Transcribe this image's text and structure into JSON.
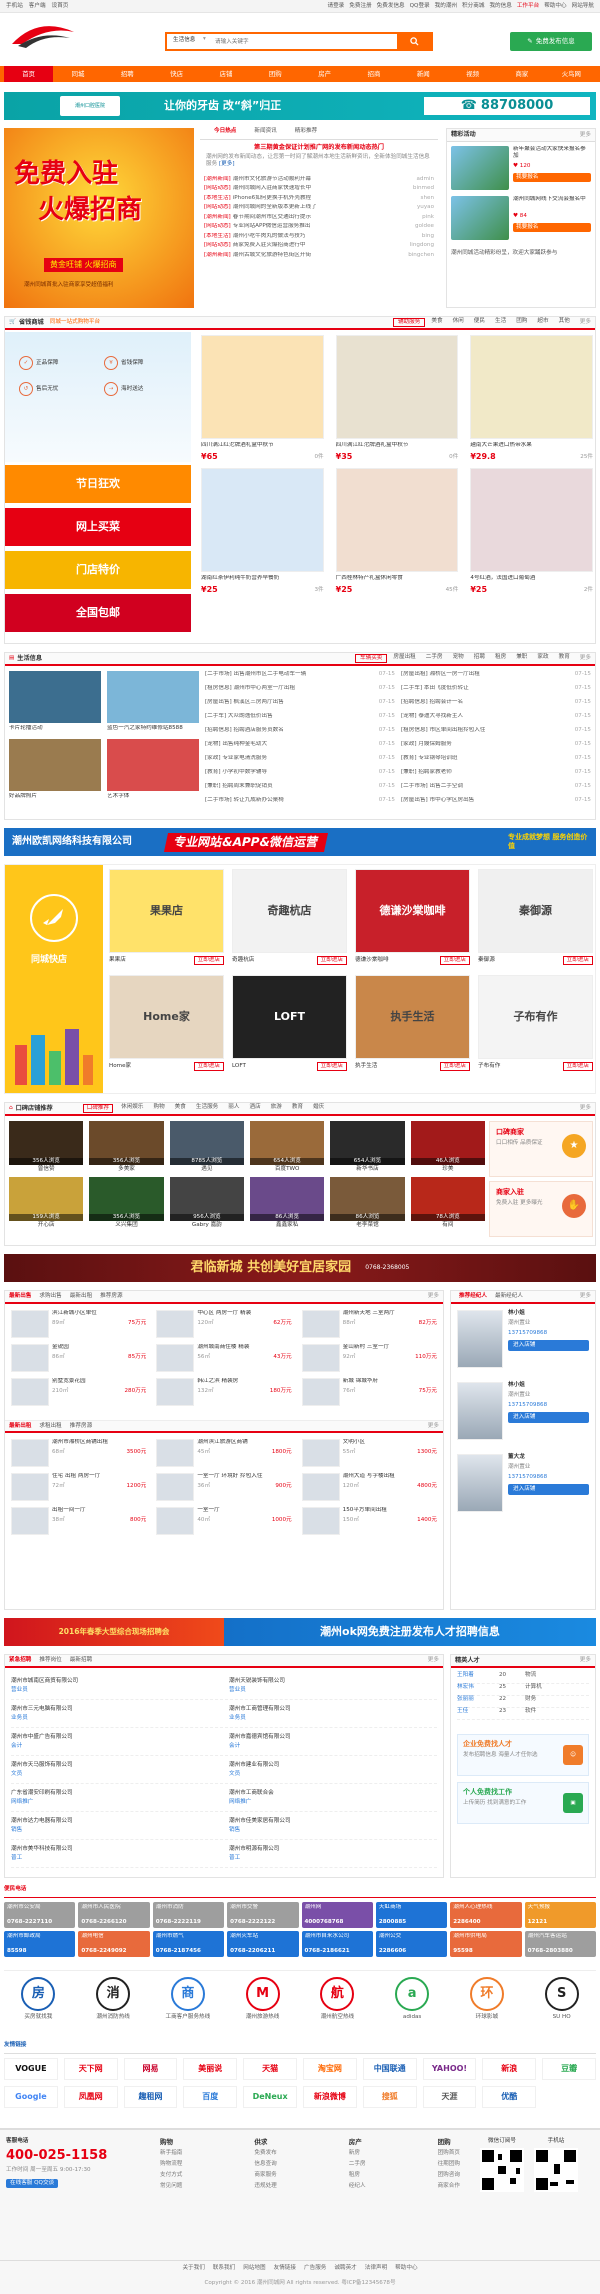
{
  "topbar": {
    "left": [
      "手机站",
      "客户端",
      "设首页"
    ],
    "right": [
      "请登录",
      "免费注册",
      "免费发信息",
      "QQ登录",
      "我的潮州",
      "积分商城",
      "我的信息",
      "工作平台",
      "帮助中心",
      "网站导航"
    ]
  },
  "header": {
    "search_tab": "生活信息",
    "search_placeholder": "请输入关键字",
    "post_button": "免费发布信息"
  },
  "nav": [
    "首页",
    "同城",
    "招聘",
    "快店",
    "店铺",
    "团购",
    "房产",
    "招商",
    "新闻",
    "视频",
    "商家",
    "火鸟网"
  ],
  "banner_ad": {
    "title": "让你的牙齿 改“斜”归正",
    "subtitle": "潮州口腔医院",
    "phone": "88708000"
  },
  "hero": {
    "line1": "免费入驻",
    "line2": "火爆招商",
    "tag": "黄金旺铺 火爆招商",
    "sub": "潮州同城首批入驻商家享受超值福利"
  },
  "news": {
    "tabs": [
      "今日热点",
      "新闻资讯",
      "精彩推荐"
    ],
    "headline": "第三期黄金保证计划推广网的发布新闻动态热门",
    "summary": "潮州网的发布新闻动态，让您第一时间了解潮州本地生活新鲜资讯，全新体验同城生活信息服务",
    "more_link": "[更多]",
    "items": [
      {
        "tag": "[潮州新闻]",
        "text": "潮州市文化旅游节活动顺利开幕",
        "src": "admin"
      },
      {
        "tag": "[网站动态]",
        "text": "潮州同城网入驻商家快速增长中",
        "src": "binmed"
      },
      {
        "tag": "[本地生活]",
        "text": "iPhone6如何更换手机外壳教程",
        "src": "shen"
      },
      {
        "tag": "[网站动态]",
        "text": "潮州同城网的全新版本更新上线了",
        "src": "yuyao"
      },
      {
        "tag": "[潮州新闻]",
        "text": "春节期间潮州市区交通出行提示",
        "src": "pink"
      },
      {
        "tag": "[网站动态]",
        "text": "专业网站APP微信运营服务推出",
        "src": "goldee"
      },
      {
        "tag": "[本地生活]",
        "text": "潮州小吃牛肉丸的做法与技巧",
        "src": "bing"
      },
      {
        "tag": "[网站动态]",
        "text": "商家免费入驻火爆招商进行中",
        "src": "lingdong"
      },
      {
        "tag": "[潮州新闻]",
        "text": "潮州古城文化旅游特色街区开街",
        "src": "bingchen"
      }
    ]
  },
  "right_panel": {
    "title": "精彩活动",
    "more": "更多",
    "activities": [
      {
        "title": "新年聚会活动大家快来报名参加",
        "count": "120",
        "button": "我要报名"
      },
      {
        "title": "潮州同城网线下交流会报名中",
        "count": "84",
        "button": "我要报名"
      }
    ],
    "caption": "潮州同城活动精彩纷呈，欢迎大家踊跃参与"
  },
  "mall": {
    "title": "省钱商城",
    "subtitle": "同城一站式购物平台",
    "tabs": [
      "辅助服务",
      "美食",
      "休闲",
      "便民",
      "生活",
      "团购",
      "超市",
      "其他"
    ],
    "more": "更多",
    "services": [
      "正品保障",
      "省钱保障",
      "售后无忧",
      "海时送达"
    ],
    "products": [
      {
        "name": "四川满江红沱牌酒礼盒中秋节",
        "price": "¥65",
        "sold": "0件"
      },
      {
        "name": "四川满江红沱牌酒礼盒中秋节",
        "price": "¥35",
        "sold": "0件"
      },
      {
        "name": "越南大芒果进口热带水果",
        "price": "¥29.8",
        "sold": "25件"
      },
      {
        "name": "湖南红茶伊利纯牛奶营养早餐奶",
        "price": "¥25",
        "sold": "3件"
      },
      {
        "name": "广西桂林特产礼盒休闲零食",
        "price": "¥25",
        "sold": "45件"
      },
      {
        "name": "4号红酒，法国进口葡萄酒",
        "price": "¥25",
        "sold": "2件"
      }
    ],
    "promos": [
      "节日狂欢",
      "网上买菜",
      "门店特价",
      "全国包邮"
    ]
  },
  "life": {
    "title": "生活信息",
    "tabs": [
      "车辆买卖",
      "房屋出租",
      "二手房",
      "宠物",
      "招聘",
      "租房",
      "兼职",
      "家政",
      "教育"
    ],
    "more": "更多",
    "photos": [
      "卡片轮播活动",
      "蓝色一汽之家特约维修站8588",
      "好品牌照片",
      "艺术字体"
    ],
    "col1": [
      "[二手市场] 出售潮州市区二手电动车一辆",
      "[租房信息] 潮州市中心两室一厅出租",
      "[房屋出售] 枫溪区三房两厅出售",
      "[二手车] 大众朗逸低价出售",
      "[招聘信息] 招聘酒店服务员数名",
      "[宠物] 出售纯种金毛幼犬",
      "[家政] 专业家电清洗服务",
      "[教育] 小学初中数学辅导",
      "[兼职] 招聘周末兼职促销员",
      "[二手市场] 转让九成新办公桌椅"
    ],
    "col2": [
      "[房屋出租] 湘桥区一房一厅出租",
      "[二手车] 本田飞度低价转让",
      "[招聘信息] 招聘会计一名",
      "[宠物] 泰迪犬寻找新主人",
      "[租房信息] 市区单间出租拎包入住",
      "[家政] 月嫂保姆服务",
      "[教育] 专业钢琴培训班",
      "[兼职] 招聘家教老师",
      "[二手市场] 出售二手空调",
      "[房屋出售] 市中心学区房出售"
    ],
    "dates": [
      "07-15",
      "07-15",
      "07-15",
      "07-15",
      "07-15",
      "07-15",
      "07-15",
      "07-15",
      "07-15",
      "07-15"
    ]
  },
  "ad2": {
    "company": "潮州欧凯网络科技有限公司",
    "slogan": "专业网站&APP&微信运营",
    "badge": "专业成就梦想 服务创造价值"
  },
  "shops": {
    "title": "同城快店",
    "items": [
      {
        "name": "果果店",
        "label": "果果店",
        "button": "立即进店"
      },
      {
        "name": "奇趣杭店",
        "label": "奇趣杭店",
        "button": "立即进店"
      },
      {
        "name": "德谦沙棠咖啡",
        "label": "德谦沙棠咖啡",
        "button": "立即进店"
      },
      {
        "name": "秦御源",
        "label": "秦御源",
        "button": "立即进店"
      },
      {
        "name": "Home家",
        "label": "Home家",
        "button": "立即进店"
      },
      {
        "name": "LOFT",
        "label": "LOFT",
        "button": "立即进店"
      },
      {
        "name": "执手生活",
        "label": "执手生活",
        "button": "立即进店"
      },
      {
        "name": "子布有作",
        "label": "子布有作",
        "button": "立即进店"
      }
    ]
  },
  "stores": {
    "title": "口碑店铺推荐",
    "tabs": [
      "口碑推荐",
      "休闲娱乐",
      "购物",
      "美食",
      "生活服务",
      "丽人",
      "酒店",
      "旅游",
      "教育",
      "婚庆"
    ],
    "more": "更多",
    "items": [
      {
        "name": "曾信赞",
        "stat": "356人浏览"
      },
      {
        "name": "多美家",
        "stat": "356人浏览"
      },
      {
        "name": "遇见",
        "stat": "8785人浏览"
      },
      {
        "name": "百度TWO",
        "stat": "654人浏览"
      },
      {
        "name": "新华书店",
        "stat": "654人浏览"
      },
      {
        "name": "珍美",
        "stat": "46人浏览"
      },
      {
        "name": "开心店",
        "stat": "159人浏览"
      },
      {
        "name": "义兴集团",
        "stat": "356人浏览"
      },
      {
        "name": "Gabry 嘉韵",
        "stat": "956人浏览"
      },
      {
        "name": "鑫鑫家私",
        "stat": "86人浏览"
      },
      {
        "name": "老李菜馆",
        "stat": "86人浏览"
      },
      {
        "name": "有间",
        "stat": "78人浏览"
      }
    ],
    "side": [
      {
        "title": "口碑商家",
        "sub": "口口相传 品质保证"
      },
      {
        "title": "商家入驻",
        "sub": "免费入驻 更多曝光"
      }
    ]
  },
  "ad3": {
    "text": "君临新城 共创美好宜居家园",
    "phone": "0768-2368005"
  },
  "houses": {
    "tabs1": [
      "最新出售",
      "求购出售",
      "最新出租",
      "推荐房源"
    ],
    "more": "更多",
    "items1": [
      {
        "name": "滨江新城小区单位",
        "area": "89",
        "price": "75万元"
      },
      {
        "name": "中心区 两房一厅 精装",
        "area": "120",
        "price": "62万元"
      },
      {
        "name": "潮州新天地 三室两厅",
        "area": "88",
        "price": "82万元"
      },
      {
        "name": "金锐园",
        "area": "86",
        "price": "85万元"
      },
      {
        "name": "潮州城南商住楼 精装",
        "area": "56",
        "price": "43万元"
      },
      {
        "name": "金山新村 三室一厅",
        "area": "92",
        "price": "110万元"
      },
      {
        "name": "别墅宽景花园",
        "area": "210",
        "price": "280万元"
      },
      {
        "name": "韩江之滨 精装房",
        "area": "132",
        "price": "180万元"
      },
      {
        "name": "新城 锦城华府",
        "area": "76",
        "price": "75万元"
      }
    ],
    "tabs2": [
      "最新出租",
      "求租出租",
      "推荐房源"
    ],
    "items2": [
      {
        "name": "潮州市湘桥区商铺出租",
        "area": "68",
        "price": "3500元"
      },
      {
        "name": "潮州滨江旅游区商铺",
        "area": "45",
        "price": "1800元"
      },
      {
        "name": "文明小区",
        "area": "55",
        "price": "1300元"
      },
      {
        "name": "住宅 出租 两房一厅",
        "area": "72",
        "price": "1200元"
      },
      {
        "name": "一室一厅 环境好 拎包入住",
        "area": "36",
        "price": "900元"
      },
      {
        "name": "潮州大道 写字楼出租",
        "area": "120",
        "price": "4800元"
      },
      {
        "name": "出租一间一厅",
        "area": "38",
        "price": "800元"
      },
      {
        "name": "一室一厅",
        "area": "40",
        "price": "1000元"
      },
      {
        "name": "150平方单间出租",
        "area": "150",
        "price": "1400元"
      }
    ],
    "agent_tabs": [
      "推荐经纪人",
      "最新经纪人"
    ],
    "agents": [
      {
        "name": "林小姐",
        "company": "潮州置业",
        "phone": "13715709868",
        "button": "进入店铺"
      },
      {
        "name": "林小姐",
        "company": "潮州置业",
        "phone": "13715709868",
        "button": "进入店铺"
      },
      {
        "name": "董大龙",
        "company": "潮州置业",
        "phone": "13715709868",
        "button": "进入店铺"
      }
    ]
  },
  "ad4": {
    "left": "2016年春季大型综合现场招聘会",
    "right": "潮州ok网免费注册发布人才招聘信息"
  },
  "jobs": {
    "tabs": [
      "紧急招聘",
      "推荐岗位",
      "最新招聘"
    ],
    "more": "更多",
    "rows": [
      [
        "潮州市城南区商贸有限公司",
        "潮州天锐装饰有限公司"
      ],
      [
        "潮州市三元电脑有限公司",
        "潮州市工商管理有限公司"
      ],
      [
        "潮州市中盛广告有限公司",
        "潮州市嘉德宾馆有限公司"
      ],
      [
        "潮州市天马服饰有限公司",
        "潮州市建业有限公司"
      ],
      [
        "广东省潮安印刷有限公司",
        "潮州市工商联合会"
      ],
      [
        "潮州市达力电器有限公司",
        "潮州市佳美家居有限公司"
      ],
      [
        "潮州市美华科技有限公司",
        "潮州市明源有限公司"
      ]
    ],
    "jobs": [
      "营业员",
      "业务员",
      "会计",
      "文员",
      "网络推广",
      "销售",
      "普工"
    ],
    "talent_title": "精英人才",
    "talents": [
      {
        "name": "王阳着",
        "age": "20",
        "job": "物流"
      },
      {
        "name": "林宏伟",
        "age": "25",
        "job": "计算机"
      },
      {
        "name": "张丽丽",
        "age": "22",
        "job": "财务"
      },
      {
        "name": "王佳",
        "age": "23",
        "job": "软件"
      }
    ],
    "cards": [
      {
        "title": "企业免费找人才",
        "sub": "发布招聘信息 海量人才任你选"
      },
      {
        "title": "个人免费找工作",
        "sub": "上传简历 找到满意的工作"
      }
    ]
  },
  "phones": {
    "title": "便民电话",
    "items": [
      {
        "name": "潮州市公安局",
        "tel": "0768-2227110",
        "color": "#9e9e9e"
      },
      {
        "name": "潮州市人民医院",
        "tel": "0768-2266120",
        "color": "#9e9e9e"
      },
      {
        "name": "潮州市消防",
        "tel": "0768-2222119",
        "color": "#9e9e9e"
      },
      {
        "name": "潮州市交警",
        "tel": "0768-2222122",
        "color": "#9e9e9e"
      },
      {
        "name": "潮州网",
        "tel": "4000768768",
        "color": "#7a4fa8"
      },
      {
        "name": "天虹商场",
        "tel": "2800885",
        "color": "#1e73d6"
      },
      {
        "name": "潮州人心理热线",
        "tel": "2286400",
        "color": "#e86a3c"
      },
      {
        "name": "天气预报",
        "tel": "12121",
        "color": "#f09a2a"
      },
      {
        "name": "潮州市邮政局",
        "tel": "85598",
        "color": "#1e73d6"
      },
      {
        "name": "潮州电信",
        "tel": "0768-2249092",
        "color": "#e86a3c"
      },
      {
        "name": "潮州市燃气",
        "tel": "0768-2187456",
        "color": "#1e73d6"
      },
      {
        "name": "潮州火车站",
        "tel": "0768-2206211",
        "color": "#1e73d6"
      },
      {
        "name": "潮州市自来水公司",
        "tel": "0768-2186621",
        "color": "#1e73d6"
      },
      {
        "name": "潮州公交",
        "tel": "2286606",
        "color": "#1e73d6"
      },
      {
        "name": "潮州市供电局",
        "tel": "95598",
        "color": "#e86a3c"
      },
      {
        "name": "潮州汽车客运站",
        "tel": "0768-2803880",
        "color": "#9e9e9e"
      }
    ]
  },
  "brands": [
    {
      "name": "买房就找我",
      "mark": "房"
    },
    {
      "name": "潮州消防热线",
      "mark": "消"
    },
    {
      "name": "工商客户服务热线",
      "mark": "商"
    },
    {
      "name": "潮州旅游热线",
      "mark": "M"
    },
    {
      "name": "潮州航空热线",
      "mark": "航"
    },
    {
      "name": "adidas",
      "mark": "a"
    },
    {
      "name": "环球影城",
      "mark": "环"
    },
    {
      "name": "SU HO",
      "mark": "S"
    }
  ],
  "links": {
    "title": "友情链接",
    "items": [
      "VOGUE",
      "天下网",
      "网易",
      "美丽说",
      "天猫",
      "淘宝网",
      "中国联通",
      "YAHOO!",
      "新浪",
      "豆瓣",
      "Google",
      "凤凰网",
      "趣租网",
      "百度",
      "DeNeux",
      "新浪微博",
      "搜狐",
      "天涯",
      "优酷"
    ]
  },
  "footer": {
    "service_label": "客服电话",
    "tel": "400-025-1158",
    "hours": "工作时间 周一至周五 9:00-17:30",
    "qq": "在线客服 QQ交谈",
    "cols": [
      {
        "title": "购物",
        "items": [
          "新手指南",
          "购物流程",
          "支付方式",
          "常见问题"
        ]
      },
      {
        "title": "供求",
        "items": [
          "免费发布",
          "信息查询",
          "商家服务",
          "违规处理"
        ]
      },
      {
        "title": "房产",
        "items": [
          "新房",
          "二手房",
          "租房",
          "经纪人"
        ]
      },
      {
        "title": "团购",
        "items": [
          "团购首页",
          "往期团购",
          "团购咨询",
          "商家合作"
        ]
      }
    ],
    "qr": [
      "微信订阅号",
      "手机站"
    ],
    "bottom_links": [
      "关于我们",
      "联系我们",
      "网站地图",
      "友情链接",
      "广告服务",
      "诚聘英才",
      "法律声明",
      "帮助中心"
    ],
    "copyright": "Copyright © 2016 潮州同城网 All rights reserved. 粤ICP备12345678号"
  }
}
